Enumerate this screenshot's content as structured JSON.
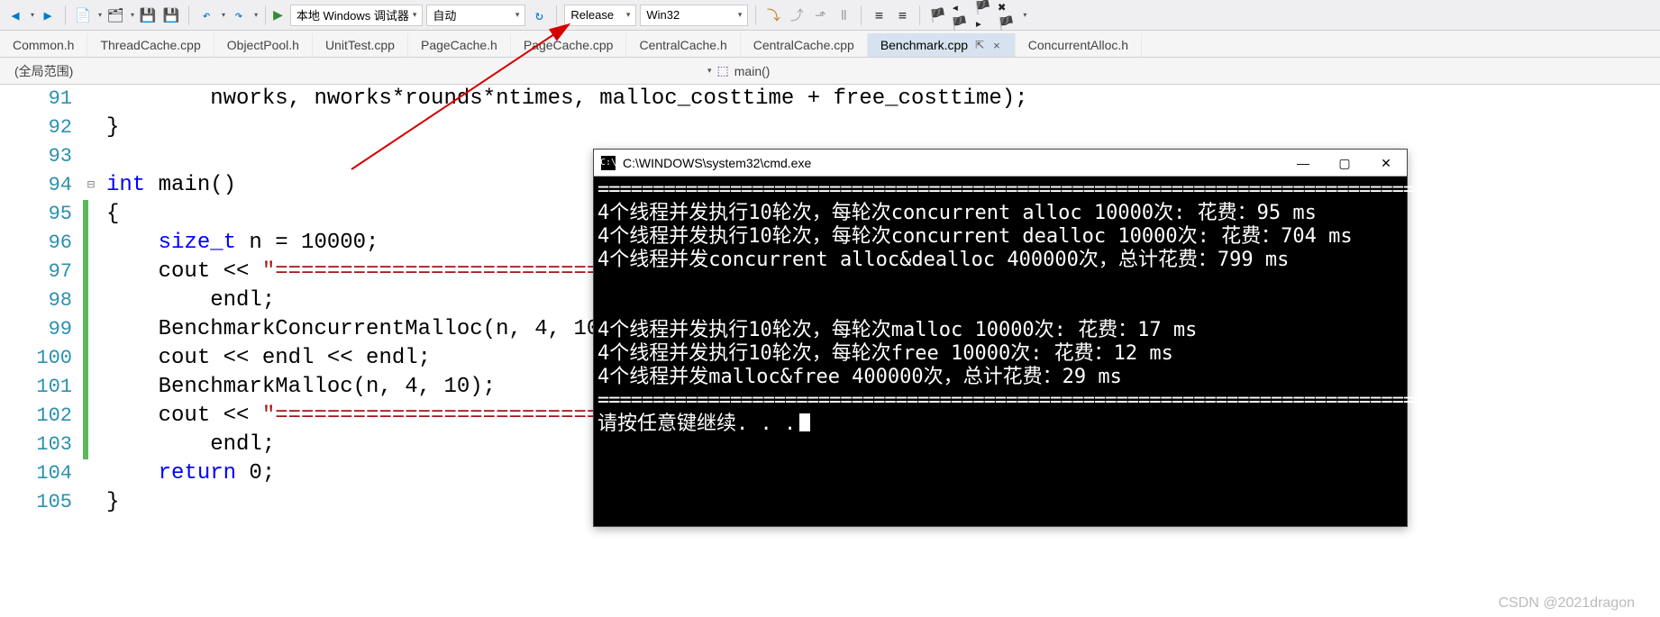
{
  "toolbar": {
    "debugger_label": "本地 Windows 调试器",
    "config_auto": "自动",
    "config_release": "Release",
    "platform": "Win32"
  },
  "tabs": [
    {
      "label": "Common.h"
    },
    {
      "label": "ThreadCache.cpp"
    },
    {
      "label": "ObjectPool.h"
    },
    {
      "label": "UnitTest.cpp"
    },
    {
      "label": "PageCache.h"
    },
    {
      "label": "PageCache.cpp"
    },
    {
      "label": "CentralCache.h"
    },
    {
      "label": "CentralCache.cpp"
    },
    {
      "label": "Benchmark.cpp",
      "active": true
    },
    {
      "label": "ConcurrentAlloc.h"
    }
  ],
  "scope": {
    "left": "(全局范围)",
    "right": "main()"
  },
  "lines": [
    {
      "n": 91,
      "mod": false,
      "fold": "",
      "html": "        nworks, nworks*rounds*ntimes, malloc_costtime + free_costtime);"
    },
    {
      "n": 92,
      "mod": false,
      "fold": "",
      "html": "}"
    },
    {
      "n": 93,
      "mod": false,
      "fold": "",
      "html": ""
    },
    {
      "n": 94,
      "mod": false,
      "fold": "⊟",
      "html": "<span class='kw'>int</span> main()"
    },
    {
      "n": 95,
      "mod": true,
      "fold": "",
      "html": "{"
    },
    {
      "n": 96,
      "mod": true,
      "fold": "",
      "html": "    <span class='type'>size_t</span> n = 10000;"
    },
    {
      "n": 97,
      "mod": true,
      "fold": "",
      "html": "    cout &lt;&lt; <span class='str'>\"=========================================================================\"</span> &lt;&lt;"
    },
    {
      "n": 98,
      "mod": true,
      "fold": "",
      "html": "        endl;"
    },
    {
      "n": 99,
      "mod": true,
      "fold": "",
      "html": "    BenchmarkConcurrentMalloc(n, 4, 10);"
    },
    {
      "n": 100,
      "mod": true,
      "fold": "",
      "html": "    cout &lt;&lt; endl &lt;&lt; endl;"
    },
    {
      "n": 101,
      "mod": true,
      "fold": "",
      "html": "    BenchmarkMalloc(n, 4, 10);"
    },
    {
      "n": 102,
      "mod": true,
      "fold": "",
      "html": "    cout &lt;&lt; <span class='str'>\"=========================================================================\"</span> &lt;&lt;"
    },
    {
      "n": 103,
      "mod": true,
      "fold": "",
      "html": "        endl;"
    },
    {
      "n": 104,
      "mod": false,
      "fold": "",
      "html": "    <span class='kw'>return</span> 0;"
    },
    {
      "n": 105,
      "mod": false,
      "fold": "",
      "html": "}"
    }
  ],
  "console": {
    "title": "C:\\WINDOWS\\system32\\cmd.exe",
    "rule": "==========================================================================",
    "l1": "4个线程并发执行10轮次，每轮次concurrent alloc 10000次: 花费：95 ms",
    "l2": "4个线程并发执行10轮次，每轮次concurrent dealloc 10000次: 花费：704 ms",
    "l3": "4个线程并发concurrent alloc&dealloc 400000次，总计花费：799 ms",
    "l4": "4个线程并发执行10轮次，每轮次malloc 10000次: 花费：17 ms",
    "l5": "4个线程并发执行10轮次，每轮次free 10000次: 花费：12 ms",
    "l6": "4个线程并发malloc&free 400000次，总计花费：29 ms",
    "prompt": "请按任意键继续. . ."
  },
  "watermark": "CSDN @2021dragon"
}
